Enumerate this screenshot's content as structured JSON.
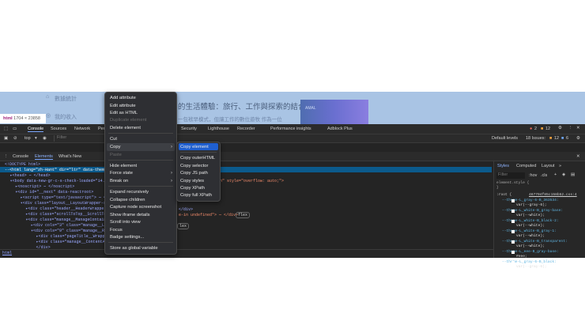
{
  "page": {
    "sidebar": [
      "數據統計",
      "我的收入"
    ],
    "heading": "的生活體驗：旅行、工作與探索的結合",
    "subtext": "一包袱早模式，但讓工作的數位遊牧 作為一位",
    "image_label": "AMAL"
  },
  "tooltip": {
    "tag": "html",
    "size": "1704 × 23858"
  },
  "devtools": {
    "tabs": [
      "Console",
      "Sources",
      "Network",
      "Per",
      "Security",
      "Lighthouse",
      "Recorder",
      "Performance insights",
      "Adblock Plus"
    ],
    "errors": "2",
    "warnings": "12",
    "console_toolbar": {
      "context": "top",
      "filter_placeholder": "Filter",
      "levels": "Default levels",
      "issues_label": "18 Issues:",
      "issues_warn": "12",
      "issues_info": "6"
    },
    "drawer_tabs": [
      "Console",
      "Elements",
      "What's New"
    ],
    "dom_lines": [
      {
        "text": "<!DOCTYPE html>"
      },
      {
        "text": "--<html lang=\"zh-Hant\" dir=\"ltr\" data-theme=\"l"
      },
      {
        "text": "▸<head> ⋯ </head>"
      },
      {
        "text": "▾<body data-new-gr-c-s-check-loaded=\"14.111"
      },
      {
        "text": "▸<noscript> ⋯ </noscript>"
      },
      {
        "text": "▾<div id=\"__next\" data-reactroot>"
      },
      {
        "text": "▸<script type=\"text/javascript\"> ⋯ </sc"
      },
      {
        "text": "▾<div class=\"layout__LayoutWrapper-sc-d"
      },
      {
        "text": "▸<div class=\"header__HeaderWrapper-sc"
      },
      {
        "text": "▸<div class=\"scrollToTop__ScrollToTop"
      },
      {
        "text": "▾<div class=\"manage__ManageContainer-"
      },
      {
        "text": "▸<div cols=\"3\" class=\"manage__LeftBa"
      },
      {
        "text": "▾<div cols=\"9\" class=\"manage__RightC"
      },
      {
        "text": "▸<div class=\"pageTitle__Wrapper-sc"
      },
      {
        "text": "▸<div class=\"manage__ContentAlignm"
      },
      {
        "text": "</div>"
      }
    ],
    "dom_right": [
      "w-hidden\" style=\"overflow: auto;\">",
      "</div>",
      "e-in undefined\"> ⋯ </div>",
      "flex",
      "lex"
    ],
    "breadcrumb": "html",
    "styles": {
      "tabs": [
        "Styles",
        "Computed",
        "Layout",
        "»"
      ],
      "filter_placeholder": "Filter",
      "hov": ":hov",
      ".cls": ".cls",
      "element_style": "element.style {",
      "close": "}",
      "root": ":root {",
      "source": "467704f85c158b52.css:4",
      "vars": [
        [
          "--theme-L_gray-6-B_363534:",
          "var(--gray-6);"
        ],
        [
          "--theme-L_white-B_gray-base:",
          "var(--white);"
        ],
        [
          "--theme-L_white-B_black-2:",
          "var(--white);"
        ],
        [
          "--theme-L_white-B_gray-1:",
          "var(--white);"
        ],
        [
          "--theme-L_white-B_transparent:",
          "var(--white);"
        ],
        [
          "--theme-L_eee-B_gray-base:",
          "#eee;"
        ],
        [
          "--theme-L_gray-6-B_black:",
          "var(--gray-6);"
        ]
      ]
    }
  },
  "context_menu": {
    "items": [
      "Add attribute",
      "Edit attribute",
      "Edit as HTML",
      "Duplicate element",
      "Delete element",
      "Cut",
      "Copy",
      "Paste",
      "Hide element",
      "Force state",
      "Break on",
      "Expand recursively",
      "Collapse children",
      "Capture node screenshot",
      "Show iframe details",
      "Scroll into view",
      "Focus",
      "Badge settings...",
      "Store as global variable"
    ]
  },
  "copy_submenu": {
    "items": [
      "Copy element",
      "Copy outerHTML",
      "Copy selector",
      "Copy JS path",
      "Copy styles",
      "Copy XPath",
      "Copy full XPath"
    ]
  },
  "colors": {
    "devtools_bg": "#242424",
    "selection": "#0b5a8c",
    "menu_highlight": "#1f5fd0",
    "page_bg": "#a9c4e4"
  }
}
